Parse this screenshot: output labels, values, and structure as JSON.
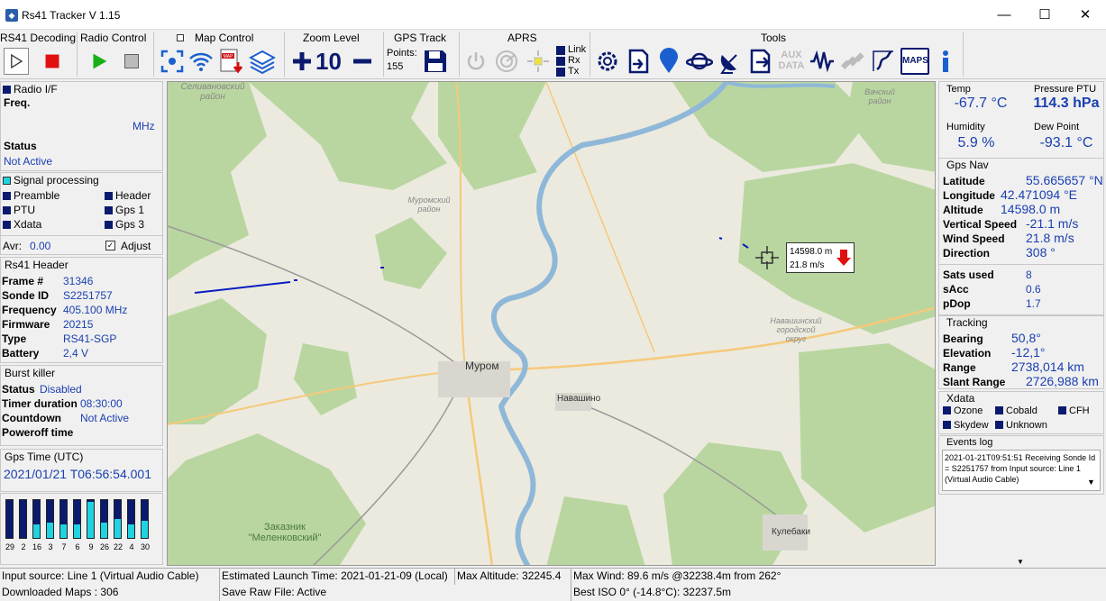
{
  "window": {
    "title": "Rs41 Tracker V 1.15",
    "minimize": "—",
    "maximize": "☐",
    "close": "✕"
  },
  "toolbar": {
    "groups": {
      "decoding": "RS41 Decoding",
      "radio": "Radio Control",
      "map": "Map Control",
      "zoom": "Zoom Level",
      "gps": "GPS Track",
      "aprs": "APRS",
      "tools": "Tools"
    },
    "zoom_value": "10",
    "gps_points_label": "Points:",
    "gps_points_value": "155",
    "aprs_link": "Link",
    "aprs_rx": "Rx",
    "aprs_tx": "Tx",
    "aux_label": "AUX",
    "data_label": "DATA",
    "maps_label": "MAPS",
    "map_label": "MAP"
  },
  "radio_if": {
    "title": "Radio  I/F",
    "freq_label": "Freq.",
    "freq_unit": "MHz",
    "status_label": "Status",
    "status_value": "Not Active"
  },
  "signal": {
    "title": "Signal processing",
    "items": [
      "Preamble",
      "Header",
      "PTU",
      "Gps 1",
      "Xdata",
      "Gps 3"
    ],
    "avr_label": "Avr:",
    "avr_value": "0.00",
    "adjust_label": "Adjust",
    "adjust_check": "✓"
  },
  "header": {
    "title": "Rs41 Header",
    "rows": [
      {
        "label": "Frame #",
        "value": "31346"
      },
      {
        "label": "Sonde ID",
        "value": "S2251757"
      },
      {
        "label": "Frequency",
        "value": "405.100 MHz"
      },
      {
        "label": "Firmware",
        "value": "20215"
      },
      {
        "label": "Type",
        "value": "RS41-SGP"
      },
      {
        "label": "Battery",
        "value": "2,4 V"
      }
    ]
  },
  "burst": {
    "title": "Burst killer",
    "status_label": "Status",
    "status_value": "Disabled",
    "timer_label": "Timer duration",
    "timer_value": "08:30:00",
    "countdown_label": "Countdown",
    "countdown_value": "Not Active",
    "poweroff_label": "Poweroff time"
  },
  "gps_time": {
    "title": "Gps Time (UTC)",
    "value": "2021/01/21 T06:56:54.001"
  },
  "sat_bars": {
    "labels": [
      "29",
      "2",
      "16",
      "3",
      "7",
      "6",
      "9",
      "26",
      "22",
      "4",
      "30"
    ],
    "levels": [
      0.0,
      0.0,
      0.35,
      0.4,
      0.35,
      0.35,
      0.95,
      0.4,
      0.5,
      0.35,
      0.45
    ]
  },
  "ptu": {
    "temp_label": "Temp",
    "temp_value": "-67.7 °C",
    "pressure_label": "Pressure PTU",
    "pressure_value": "114.3 hPa",
    "humidity_label": "Humidity",
    "humidity_value": "5.9 %",
    "dew_label": "Dew Point",
    "dew_value": "-93.1 °C"
  },
  "gps_nav": {
    "title": "Gps Nav",
    "rows": [
      {
        "label": "Latitude",
        "value": "55.665657 °N"
      },
      {
        "label": "Longitude",
        "value": "42.471094 °E"
      },
      {
        "label": "Altitude",
        "value": "14598.0 m"
      },
      {
        "label": "Vertical Speed",
        "value": "-21.1 m/s"
      },
      {
        "label": "Wind Speed",
        "value": "21.8 m/s"
      },
      {
        "label": "Direction",
        "value": "308 °"
      }
    ],
    "sat_rows": [
      {
        "label": "Sats used",
        "value": "8"
      },
      {
        "label": "sAcc",
        "value": "0.6"
      },
      {
        "label": "pDop",
        "value": "1.7"
      }
    ]
  },
  "tracking": {
    "title": "Tracking",
    "rows": [
      {
        "label": "Bearing",
        "value": "50,8°"
      },
      {
        "label": "Elevation",
        "value": "-12,1°"
      },
      {
        "label": "Range",
        "value": "2738,014 km"
      },
      {
        "label": "Slant Range",
        "value": "2726,988 km"
      }
    ]
  },
  "xdata": {
    "title": "Xdata",
    "items": [
      "Ozone",
      "Cobald",
      "CFH",
      "Skydew",
      "Unknown"
    ]
  },
  "events": {
    "title": "Events log",
    "text": "2021-01-21T09:51:51 Receiving Sonde Id = S2251757 from Input source: Line 1 (Virtual Audio Cable)"
  },
  "map": {
    "labels": {
      "selivanovsky": "Селивановский\nрайон",
      "muromsky": "Муромский\nрайон",
      "murom": "Муром",
      "navashino": "Навашино",
      "navashinsky": "Навашинский\nгородской\nокруг",
      "vachsky": "Вачский\nрайон",
      "kulebaki": "Кулебаки",
      "reserve": "Заказник\n\"Меленковский\""
    },
    "marker_alt": "14598.0 m",
    "marker_speed": "21.8 m/s"
  },
  "status": {
    "input_source": "Input source: Line 1 (Virtual Audio Cable)",
    "launch_time": "Estimated Launch Time: 2021-01-21-09 (Local)",
    "max_alt": "Max Altitude: 32245.4",
    "max_wind": "Max Wind: 89.6 m/s @32238.4m from 262°",
    "downloaded": "Downloaded Maps : 306",
    "save_raw": "Save Raw File: Active",
    "best_iso": "Best ISO 0° (-14.8°C): 32237.5m"
  },
  "colors": {
    "value_blue": "#1a3fb0",
    "indicator_dark": "#0a1a6e",
    "indicator_cyan": "#1fd4e0",
    "river": "#8fb8d8",
    "forest": "#b9d6a0"
  }
}
